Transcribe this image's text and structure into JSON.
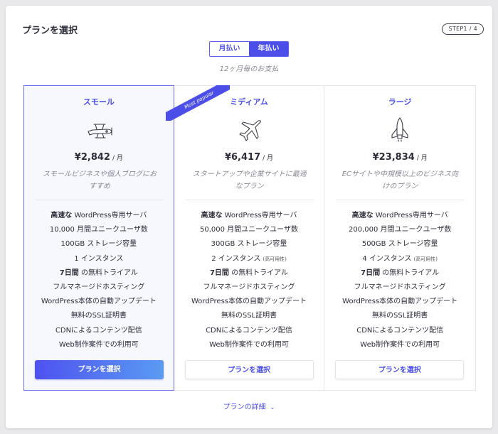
{
  "header": {
    "title": "プランを選択",
    "step": "STEP1 / 4"
  },
  "billing": {
    "options": [
      {
        "label": "月払い",
        "active": false
      },
      {
        "label": "年払い",
        "active": true
      }
    ],
    "note": "12ヶ月毎のお支払"
  },
  "ribbon": "Most popular",
  "plans": [
    {
      "name": "スモール",
      "icon": "biplane-icon",
      "price": "¥2,842",
      "unit": "/ 月",
      "desc_line1": "スモールビジネスや個人ブログにお",
      "desc_line2": "すすめ",
      "features": [
        {
          "strong": "高速な",
          "text": " WordPress専用サーバ"
        },
        {
          "text": "10,000 月間ユニークユーザ数"
        },
        {
          "text": "100GB ストレージ容量"
        },
        {
          "text": "1 インスタンス"
        },
        {
          "strong": "7日間",
          "text": " の無料トライアル"
        },
        {
          "text": "フルマネージドホスティング"
        },
        {
          "text": "WordPress本体の自動アップデート"
        },
        {
          "text": "無料のSSL証明書"
        },
        {
          "text": "CDNによるコンテンツ配信"
        },
        {
          "text": "Web制作案件での利用可"
        }
      ],
      "button": "プランを選択",
      "selected": true
    },
    {
      "name": "ミディアム",
      "icon": "jet-plane-icon",
      "price": "¥6,417",
      "unit": "/ 月",
      "desc_line1": "スタートアップや企業サイトに最適",
      "desc_line2": "なプラン",
      "features": [
        {
          "strong": "高速な",
          "text": " WordPress専用サーバ"
        },
        {
          "text": "50,000 月間ユニークユーザ数"
        },
        {
          "text": "300GB ストレージ容量"
        },
        {
          "text": "2 インスタンス",
          "small": "(高可用性)"
        },
        {
          "strong": "7日間",
          "text": " の無料トライアル"
        },
        {
          "text": "フルマネージドホスティング"
        },
        {
          "text": "WordPress本体の自動アップデート"
        },
        {
          "text": "無料のSSL証明書"
        },
        {
          "text": "CDNによるコンテンツ配信"
        },
        {
          "text": "Web制作案件での利用可"
        }
      ],
      "button": "プランを選択",
      "selected": false
    },
    {
      "name": "ラージ",
      "icon": "space-shuttle-icon",
      "price": "¥23,834",
      "unit": "/ 月",
      "desc_line1": "ECサイトや中規模以上のビジネス向",
      "desc_line2": "けのプラン",
      "features": [
        {
          "strong": "高速な",
          "text": " WordPress専用サーバ"
        },
        {
          "text": "200,000 月間ユニークユーザ数"
        },
        {
          "text": "500GB ストレージ容量"
        },
        {
          "text": "4 インスタンス",
          "small": "(高可用性)"
        },
        {
          "strong": "7日間",
          "text": " の無料トライアル"
        },
        {
          "text": "フルマネージドホスティング"
        },
        {
          "text": "WordPress本体の自動アップデート"
        },
        {
          "text": "無料のSSL証明書"
        },
        {
          "text": "CDNによるコンテンツ配信"
        },
        {
          "text": "Web制作案件での利用可"
        }
      ],
      "button": "プランを選択",
      "selected": false
    }
  ],
  "details_link": "プランの詳細",
  "colors": {
    "accent": "#4b4fe8",
    "text": "#2d2d3a",
    "muted": "#8a8a96",
    "border": "#e4e4ea"
  }
}
